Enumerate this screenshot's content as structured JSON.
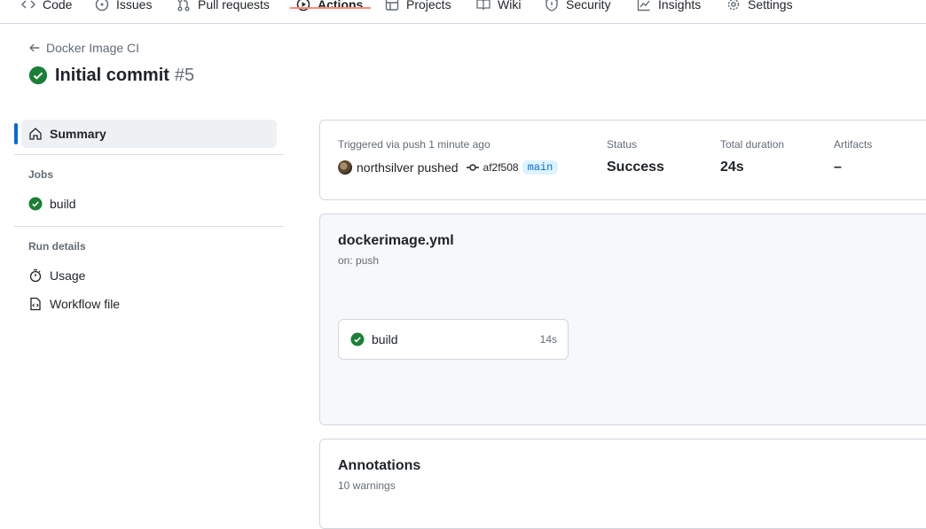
{
  "tabs": [
    {
      "label": "Code",
      "icon": "code-icon"
    },
    {
      "label": "Issues",
      "icon": "issue-icon"
    },
    {
      "label": "Pull requests",
      "icon": "pull-request-icon"
    },
    {
      "label": "Actions",
      "icon": "play-icon",
      "active": true
    },
    {
      "label": "Projects",
      "icon": "table-icon"
    },
    {
      "label": "Wiki",
      "icon": "book-icon"
    },
    {
      "label": "Security",
      "icon": "shield-icon"
    },
    {
      "label": "Insights",
      "icon": "graph-icon"
    },
    {
      "label": "Settings",
      "icon": "gear-icon"
    }
  ],
  "header": {
    "back_label": "Docker Image CI",
    "title": "Initial commit",
    "run_number": "#5",
    "status_icon": "check-circle-icon"
  },
  "sidebar": {
    "summary_label": "Summary",
    "jobs_heading": "Jobs",
    "jobs": [
      {
        "label": "build",
        "status": "success"
      }
    ],
    "run_details_heading": "Run details",
    "details": [
      {
        "label": "Usage",
        "icon": "stopwatch-icon"
      },
      {
        "label": "Workflow file",
        "icon": "file-code-icon"
      }
    ]
  },
  "summary": {
    "trigger_text": "Triggered via push 1 minute ago",
    "user": "northsilver",
    "action": "pushed",
    "commit_sha": "af2f508",
    "branch": "main",
    "status_label": "Status",
    "status_value": "Success",
    "duration_label": "Total duration",
    "duration_value": "24s",
    "artifacts_label": "Artifacts",
    "artifacts_value": "–"
  },
  "workflow": {
    "file": "dockerimage.yml",
    "trigger": "on: push",
    "jobs": [
      {
        "name": "build",
        "duration": "14s",
        "status": "success"
      }
    ]
  },
  "annotations": {
    "title": "Annotations",
    "subtitle": "10 warnings"
  },
  "colors": {
    "success": "#1a7f37",
    "accent": "#0969da",
    "active_tab_underline": "#fd8c73"
  }
}
